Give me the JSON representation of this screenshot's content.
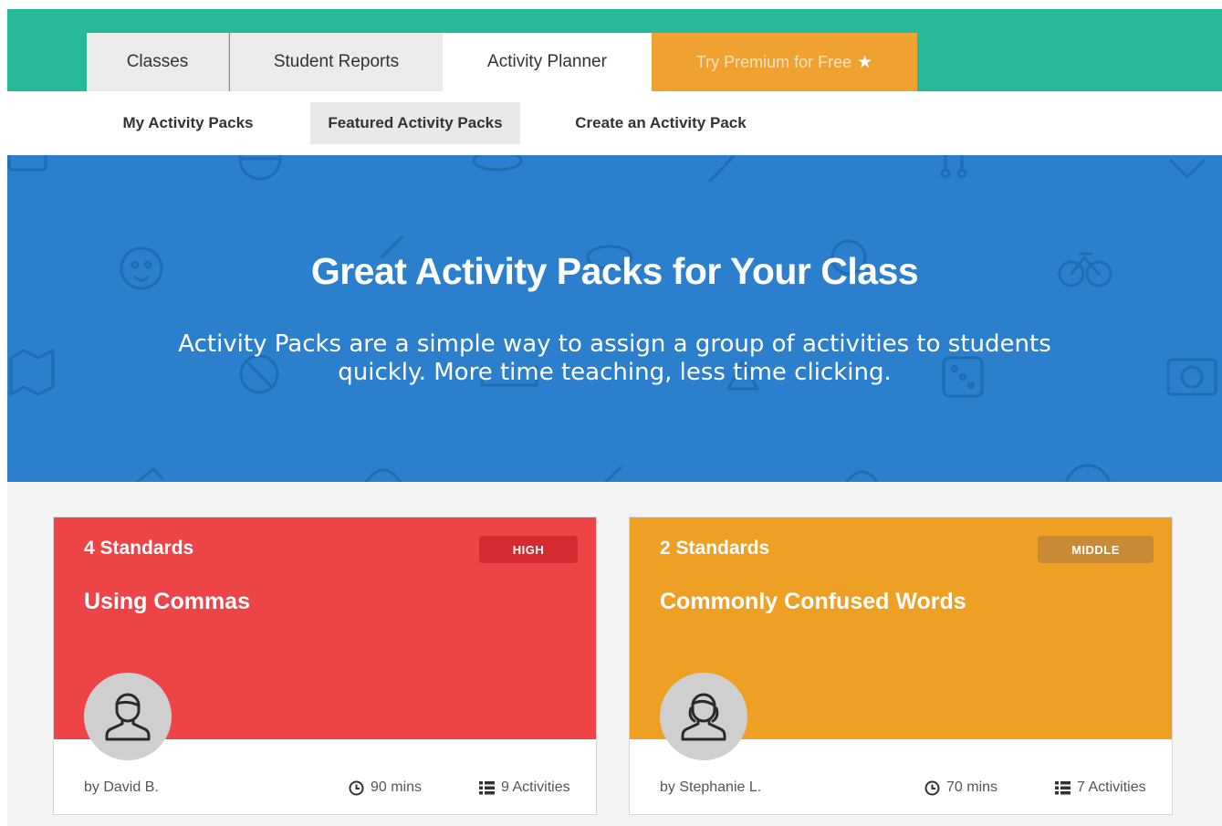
{
  "tabs": {
    "classes": "Classes",
    "student_reports": "Student Reports",
    "activity_planner": "Activity Planner",
    "premium": "Try Premium for Free"
  },
  "subnav": {
    "my_packs": "My Activity Packs",
    "featured_packs": "Featured Activity Packs",
    "create_pack": "Create an Activity Pack"
  },
  "hero": {
    "title": "Great Activity Packs for Your Class",
    "subtitle": "Activity Packs are a simple way to assign a group of activities to students quickly. More time teaching, less time clicking."
  },
  "cards": [
    {
      "standards": "4 Standards",
      "level": "HIGH",
      "title": "Using Commas",
      "author": "by David B.",
      "time": "90 mins",
      "activities": "9 Activities"
    },
    {
      "standards": "2 Standards",
      "level": "MIDDLE",
      "title": "Commonly Confused Words",
      "author": "by Stephanie L.",
      "time": "70 mins",
      "activities": "7 Activities"
    }
  ],
  "colors": {
    "topbar": "#26b99a",
    "premium": "#f0a230",
    "hero": "#2b7fcc",
    "card_high": "#ed4448",
    "card_middle": "#eda023"
  },
  "icons": {
    "premium": "star-icon",
    "time": "clock-icon",
    "activities": "list-icon",
    "avatar": "person-icon"
  }
}
